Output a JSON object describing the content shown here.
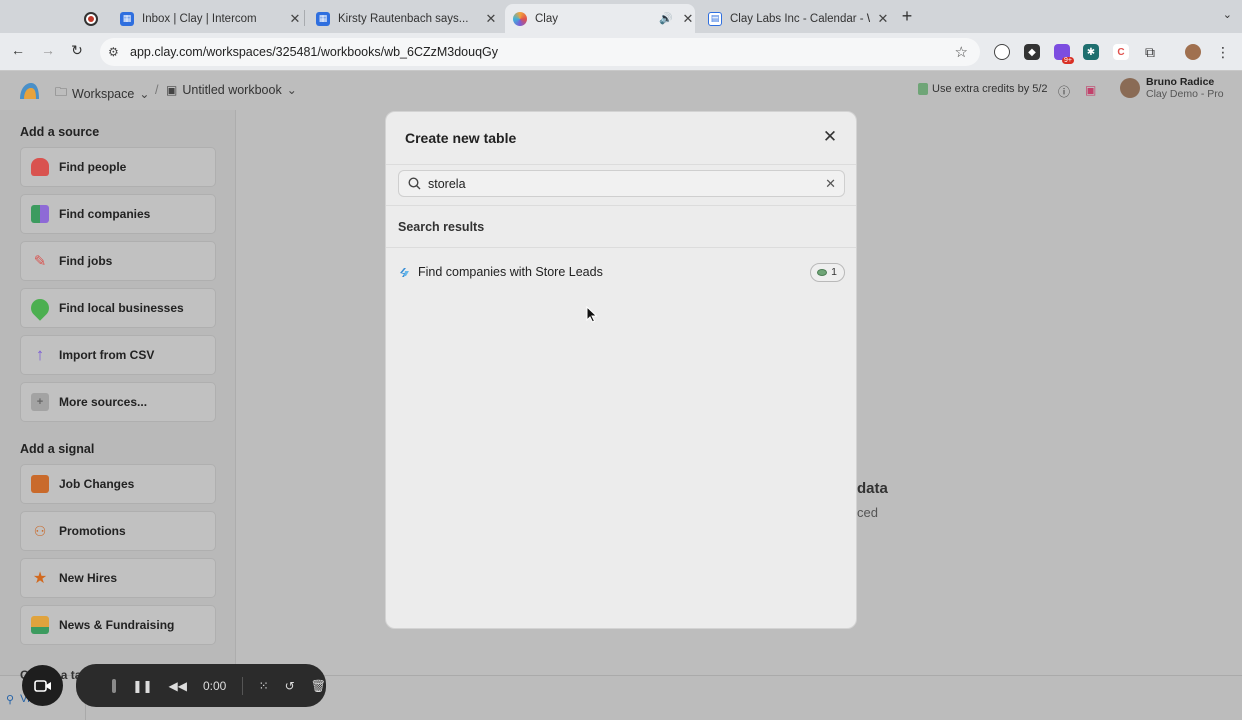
{
  "browser": {
    "tabs": [
      {
        "title": "Inbox | Clay | Intercom",
        "icon": "intercom-icon",
        "active": false
      },
      {
        "title": "Kirsty Rautenbach says...",
        "icon": "intercom-icon",
        "active": false
      },
      {
        "title": "Clay",
        "icon": "clay-icon",
        "active": true
      },
      {
        "title": "Clay Labs Inc - Calendar - W",
        "icon": "calendar-icon",
        "active": false
      }
    ],
    "url": "app.clay.com/workspaces/325481/workbooks/wb_6CZzM3douqGy",
    "extension_badge": "9+"
  },
  "header": {
    "workspace": "Workspace",
    "workbook": "Untitled workbook",
    "credits_text": "Use extra credits by 5/2",
    "user_name": "Bruno Radice",
    "user_org": "Clay Demo - Pro"
  },
  "sidebar": {
    "source_title": "Add a source",
    "sources": [
      {
        "label": "Find people",
        "icon": "person-icon"
      },
      {
        "label": "Find companies",
        "icon": "buildings-icon"
      },
      {
        "label": "Find jobs",
        "icon": "pencil-icon"
      },
      {
        "label": "Find local businesses",
        "icon": "map-pin-icon"
      },
      {
        "label": "Import from CSV",
        "icon": "upload-arrow-icon"
      },
      {
        "label": "More sources...",
        "icon": "plus-box-icon"
      }
    ],
    "signal_title": "Add a signal",
    "signals": [
      {
        "label": "Job Changes",
        "icon": "briefcase-icon"
      },
      {
        "label": "Promotions",
        "icon": "people-icon"
      },
      {
        "label": "New Hires",
        "icon": "star-icon"
      },
      {
        "label": "News & Fundraising",
        "icon": "chart-icon"
      }
    ],
    "partial_section": "Create a ta",
    "view_link": "View"
  },
  "main": {
    "bg_heading_fragment": "data",
    "bg_sub_fragment": "ced"
  },
  "modal": {
    "title": "Create new table",
    "search_value": "storela",
    "search_placeholder": "Search",
    "results_title": "Search results",
    "results": [
      {
        "label": "Find companies with Store Leads",
        "credits": "1"
      }
    ]
  },
  "recorder": {
    "time": "0:00"
  },
  "colors": {
    "accent": "#2563a8",
    "overlay": "#bdbdbd",
    "modal_bg": "#ececec"
  }
}
